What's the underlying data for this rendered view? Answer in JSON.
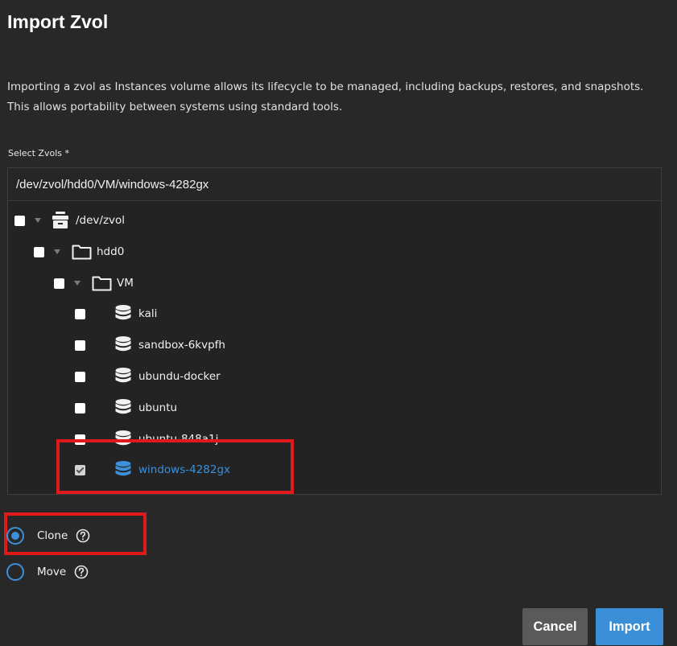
{
  "dialog": {
    "title": "Import Zvol",
    "description": [
      "Importing a zvol as Instances volume allows its lifecycle to be managed, including backups, restores, and snapshots.",
      "This allows portability between systems using standard tools."
    ]
  },
  "field": {
    "label": "Select Zvols *",
    "value": "/dev/zvol/hdd0/VM/windows-4282gx"
  },
  "tree": {
    "root": {
      "label": "/dev/zvol",
      "icon": "database-stack-icon",
      "checked": false,
      "expanded": true
    },
    "pool": {
      "label": "hdd0",
      "icon": "folder-icon",
      "checked": false,
      "expanded": true
    },
    "dataset": {
      "label": "VM",
      "icon": "folder-icon",
      "checked": false,
      "expanded": true
    },
    "zvols": [
      {
        "label": "kali",
        "icon": "database-icon",
        "checked": false
      },
      {
        "label": "sandbox-6kvpfh",
        "icon": "database-icon",
        "checked": false
      },
      {
        "label": "ubundu-docker",
        "icon": "database-icon",
        "checked": false
      },
      {
        "label": "ubuntu",
        "icon": "database-icon",
        "checked": false
      },
      {
        "label": "ubuntu-848a1j",
        "icon": "database-icon",
        "checked": false
      },
      {
        "label": "windows-4282gx",
        "icon": "database-icon",
        "checked": true
      }
    ]
  },
  "mode": {
    "options": [
      {
        "label": "Clone",
        "selected": true
      },
      {
        "label": "Move",
        "selected": false
      }
    ]
  },
  "actions": {
    "cancel": "Cancel",
    "import": "Import"
  },
  "colors": {
    "accent": "#3a8fd6",
    "highlight": "#e01a1a",
    "background": "#282828"
  }
}
